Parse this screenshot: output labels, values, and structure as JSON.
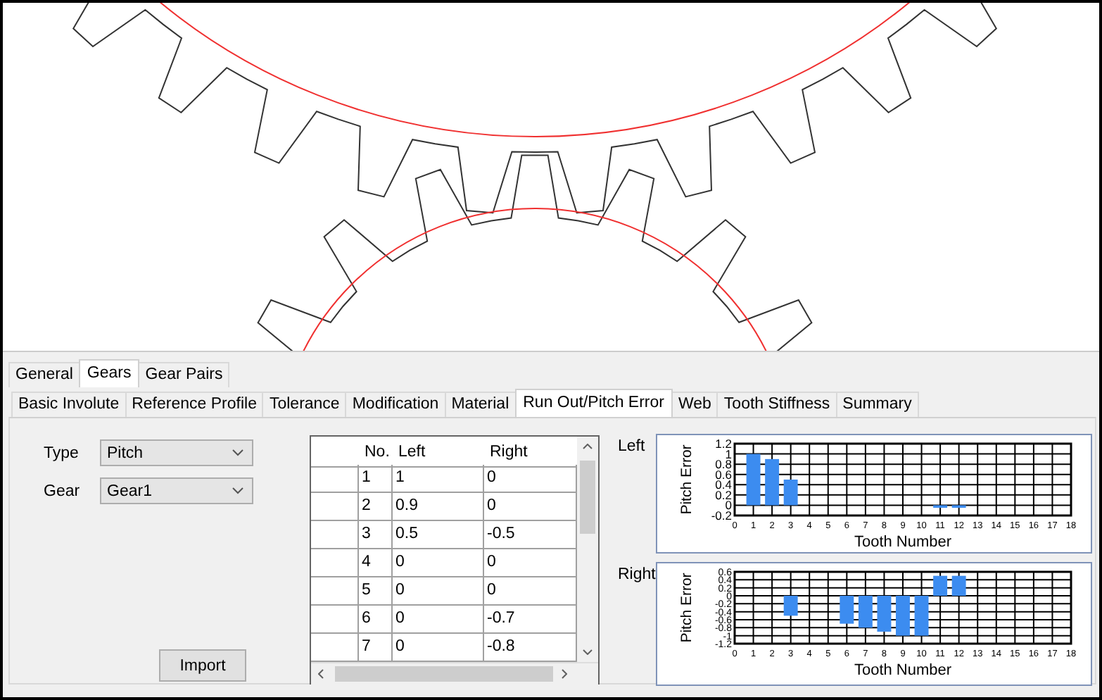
{
  "tabs": [
    {
      "label": "General",
      "selected": false
    },
    {
      "label": "Gears",
      "selected": true
    },
    {
      "label": "Gear Pairs",
      "selected": false
    }
  ],
  "subtabs": [
    {
      "label": "Basic Involute",
      "selected": false
    },
    {
      "label": "Reference Profile",
      "selected": false
    },
    {
      "label": "Tolerance",
      "selected": false
    },
    {
      "label": "Modification",
      "selected": false
    },
    {
      "label": "Material",
      "selected": false
    },
    {
      "label": "Run Out/Pitch Error",
      "selected": true
    },
    {
      "label": "Web",
      "selected": false
    },
    {
      "label": "Tooth Stiffness",
      "selected": false
    },
    {
      "label": "Summary",
      "selected": false
    }
  ],
  "fields": [
    {
      "label": "Type",
      "value": "Pitch"
    },
    {
      "label": "Gear",
      "value": "Gear1"
    }
  ],
  "import_button": "Import",
  "table": {
    "columns": [
      "No.",
      "Left",
      "Right"
    ],
    "rows": [
      [
        "1",
        "1",
        "0"
      ],
      [
        "2",
        "0.9",
        "0"
      ],
      [
        "3",
        "0.5",
        "-0.5"
      ],
      [
        "4",
        "0",
        "0"
      ],
      [
        "5",
        "0",
        "0"
      ],
      [
        "6",
        "0",
        "-0.7"
      ],
      [
        "7",
        "0",
        "-0.8"
      ]
    ]
  },
  "charts": [
    {
      "label": "Left",
      "chart_data": {
        "type": "bar",
        "xlabel": "Tooth Number",
        "ylabel": "Pitch Error",
        "x": [
          1,
          2,
          3,
          4,
          5,
          6,
          7,
          8,
          9,
          10,
          11,
          12
        ],
        "series": [
          {
            "color": "#3c8cf0",
            "values": [
              1,
              0.9,
              0.5,
              0,
              0,
              0,
              0,
              0,
              0,
              0,
              -0.05,
              -0.05
            ]
          }
        ],
        "grid": true,
        "xlim": [
          0,
          18
        ],
        "ylim": [
          -0.2,
          1.2
        ],
        "xticks": [
          0,
          1,
          2,
          3,
          4,
          5,
          6,
          7,
          8,
          9,
          10,
          11,
          12,
          13,
          14,
          15,
          16,
          17,
          18
        ],
        "yticks": [
          -0.2,
          0,
          0.2,
          0.4,
          0.6,
          0.8,
          1,
          1.2
        ]
      }
    },
    {
      "label": "Right",
      "chart_data": {
        "type": "bar",
        "xlabel": "Tooth Number",
        "ylabel": "Pitch Error",
        "x": [
          1,
          2,
          3,
          4,
          5,
          6,
          7,
          8,
          9,
          10,
          11,
          12
        ],
        "series": [
          {
            "color": "#3c8cf0",
            "values": [
              0,
              0,
              -0.5,
              0,
              0,
              -0.7,
              -0.8,
              -0.9,
              -1,
              -1,
              0.5,
              0.5
            ]
          }
        ],
        "grid": true,
        "xlim": [
          0,
          18
        ],
        "ylim": [
          -1.2,
          0.6
        ],
        "xticks": [
          0,
          1,
          2,
          3,
          4,
          5,
          6,
          7,
          8,
          9,
          10,
          11,
          12,
          13,
          14,
          15,
          16,
          17,
          18
        ],
        "yticks": [
          -1.2,
          -1,
          -0.8,
          -0.6,
          -0.4,
          -0.2,
          0,
          0.2,
          0.4,
          0.6
        ]
      }
    }
  ]
}
